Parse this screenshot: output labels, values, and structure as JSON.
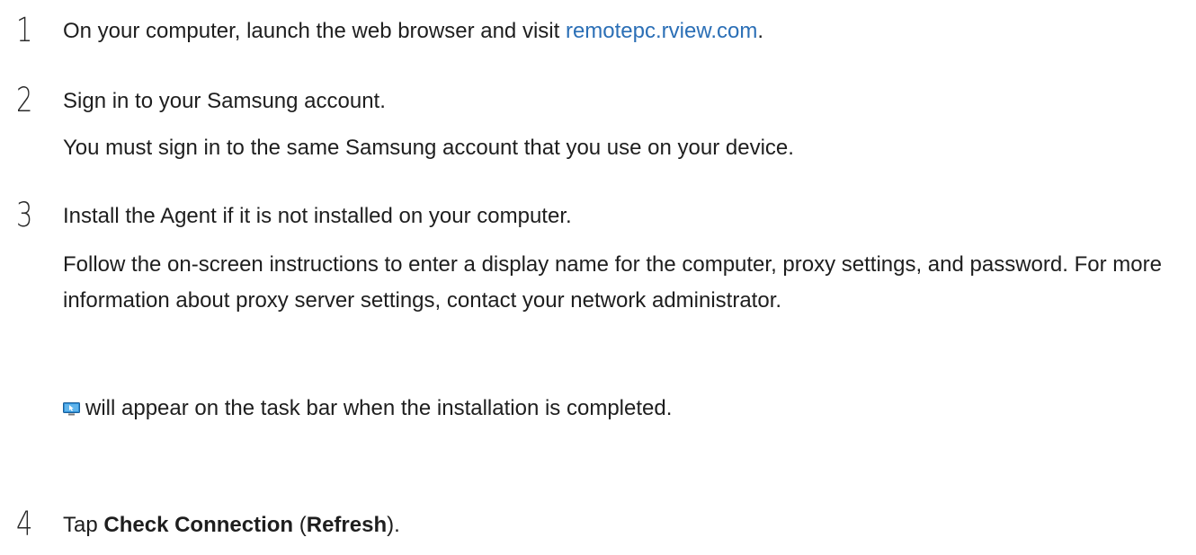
{
  "steps": [
    {
      "number": "1",
      "text_before": "On your computer, launch the web browser and visit ",
      "link": "remotepc.rview.com",
      "text_after": "."
    },
    {
      "number": "2",
      "text": "Sign in to your Samsung account.",
      "note": "You must sign in to the same Samsung account that you use on your device."
    },
    {
      "number": "3",
      "text": "Install the Agent if it is not installed on your computer.",
      "note": "Follow the on-screen instructions to enter a display name for the computer, proxy settings, and password. For more information about proxy server settings, contact your network administrator.",
      "icon": "remote-pc-agent-icon",
      "icon_text": "will appear on the task bar when the installation is completed."
    },
    {
      "number": "4",
      "text_before": "Tap ",
      "bold": "Check Connection",
      "middle": " (",
      "bold2": "Refresh",
      "text_after": ")."
    }
  ],
  "colors": {
    "text": "#1e1e1e",
    "link": "#2b6fb6",
    "icon_blue": "#2e8fd6"
  }
}
